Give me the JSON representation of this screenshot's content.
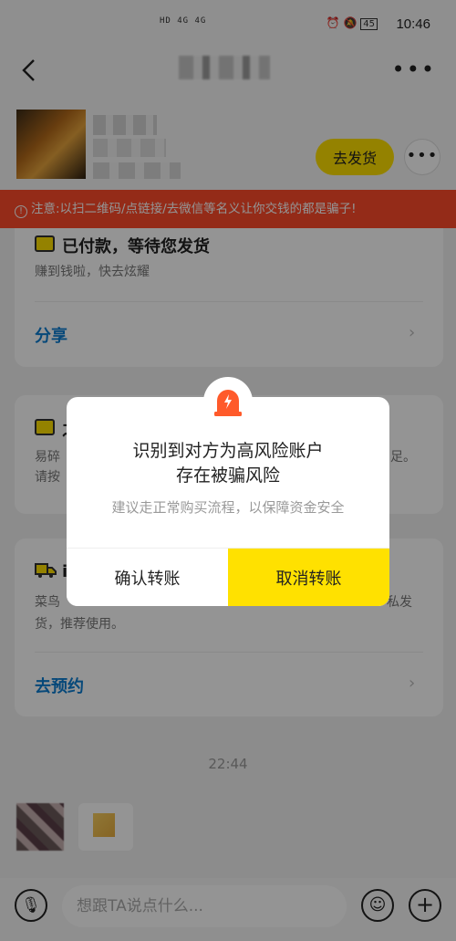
{
  "status_bar": {
    "time": "10:46",
    "signal_text": "HD 4G 4G",
    "battery": "45"
  },
  "header": {
    "back_icon": "chevron-left-icon",
    "more_icon": "more-dots-icon"
  },
  "seller": {
    "ship_button": "去发货",
    "more_icon": "more-circle-icon"
  },
  "banner": {
    "text": "注意:以扫二维码/点链接/去微信等名义让你交钱的都是骗子!",
    "color": "#ff4a2a"
  },
  "order_card": {
    "title": "已付款，等待您发货",
    "subtitle": "赚到钱啦，快去炫耀",
    "link": "分享"
  },
  "card2": {
    "title_start": "之",
    "line1_start": "易碎",
    "line1_end": "足。",
    "line2_start": "请按"
  },
  "card3": {
    "title_start": "i",
    "line1_start": "菜鸟",
    "line1_end": "私发",
    "line2": "货，推荐使用。",
    "link": "去预约"
  },
  "chat": {
    "timestamp": "22:44"
  },
  "input_bar": {
    "placeholder": "想跟TA说点什么...",
    "mic_icon": "microphone-icon",
    "emoji_icon": "emoji-icon",
    "plus_icon": "plus-icon"
  },
  "dialog": {
    "icon": "alarm-siren-icon",
    "title_line1": "识别到对方为高风险账户",
    "title_line2": "存在被骗风险",
    "subtitle": "建议走正常购买流程，以保障资金安全",
    "confirm_button": "确认转账",
    "cancel_button": "取消转账",
    "accent": "#ffe100",
    "alarm_color": "#ff5a2a"
  }
}
